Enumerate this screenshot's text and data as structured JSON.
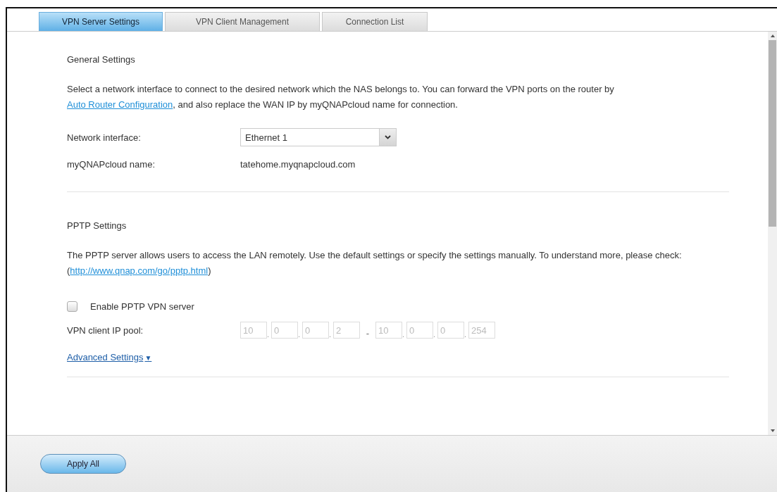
{
  "tabs": [
    {
      "label": "VPN Server Settings",
      "selected": true
    },
    {
      "label": "VPN Client Management",
      "selected": false
    },
    {
      "label": "Connection List",
      "selected": false
    }
  ],
  "general": {
    "title": "General Settings",
    "description": [
      {
        "kind": "text",
        "text": "Select a network interface to connect to the desired network which the NAS belongs to. You can forward the VPN ports on the router by "
      },
      {
        "kind": "link",
        "text": "Auto Router Configuration"
      },
      {
        "kind": "text",
        "text": ", and also replace the WAN IP by myQNAPcloud name for connection."
      }
    ],
    "network_interface": {
      "label": "Network interface:",
      "value": "Ethernet 1"
    },
    "cloud_name": {
      "label": "myQNAPcloud name:",
      "value": "tatehome.myqnapcloud.com"
    }
  },
  "pptp": {
    "title": "PPTP Settings",
    "description": [
      {
        "kind": "text",
        "text": "The PPTP server allows users to access the LAN remotely. Use the default settings or specify the settings manually. To understand more, please check: ("
      },
      {
        "kind": "link",
        "text": "http://www.qnap.com/go/pptp.html"
      },
      {
        "kind": "text",
        "text": ")"
      }
    ],
    "enable": {
      "label": "Enable PPTP VPN server",
      "checked": false
    },
    "ip_pool": {
      "label": "VPN client IP pool:",
      "disabled": true,
      "parts": [
        {
          "kind": "octet",
          "text": "10"
        },
        {
          "kind": "dot",
          "text": "."
        },
        {
          "kind": "octet",
          "text": "0"
        },
        {
          "kind": "dot",
          "text": "."
        },
        {
          "kind": "octet",
          "text": "0"
        },
        {
          "kind": "dot",
          "text": "."
        },
        {
          "kind": "octet",
          "text": "2"
        },
        {
          "kind": "dash",
          "text": "-"
        },
        {
          "kind": "octet",
          "text": "10"
        },
        {
          "kind": "dot",
          "text": "."
        },
        {
          "kind": "octet",
          "text": "0"
        },
        {
          "kind": "dot",
          "text": "."
        },
        {
          "kind": "octet",
          "text": "0"
        },
        {
          "kind": "dot",
          "text": "."
        },
        {
          "kind": "octet",
          "text": "254"
        }
      ]
    },
    "advanced": {
      "label": "Advanced Settings",
      "arrow": "▼"
    }
  },
  "footer": {
    "button": "Apply All"
  }
}
